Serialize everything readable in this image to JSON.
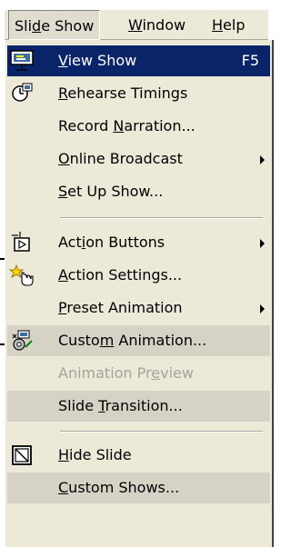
{
  "menubar": {
    "items": [
      {
        "label_pre": "Sli",
        "label_acc": "d",
        "label_post": "e Show"
      },
      {
        "label_pre": "",
        "label_acc": "W",
        "label_post": "indow"
      },
      {
        "label_pre": "",
        "label_acc": "H",
        "label_post": "elp"
      }
    ]
  },
  "menu": {
    "items": [
      {
        "pre": "",
        "acc": "V",
        "post": "iew Show",
        "shortcut": "F5",
        "icon": "view-show-icon",
        "state": "selected"
      },
      {
        "pre": "",
        "acc": "R",
        "post": "ehearse Timings",
        "icon": "rehearse-timings-icon",
        "state": "normal"
      },
      {
        "pre": "Record ",
        "acc": "N",
        "post": "arration...",
        "icon": "",
        "state": "normal"
      },
      {
        "pre": "",
        "acc": "O",
        "post": "nline Broadcast",
        "icon": "",
        "state": "normal",
        "submenu": true
      },
      {
        "pre": "",
        "acc": "S",
        "post": "et Up Show...",
        "icon": "",
        "state": "normal"
      },
      {
        "pre": "Act",
        "acc": "i",
        "post": "on Buttons",
        "icon": "action-buttons-icon",
        "state": "normal",
        "submenu": true
      },
      {
        "pre": "",
        "acc": "A",
        "post": "ction Settings...",
        "icon": "action-settings-icon",
        "state": "normal"
      },
      {
        "pre": "",
        "acc": "P",
        "post": "reset Animation",
        "icon": "",
        "state": "normal",
        "submenu": true
      },
      {
        "pre": "Custo",
        "acc": "m",
        "post": " Animation...",
        "icon": "custom-animation-icon",
        "state": "hover"
      },
      {
        "pre": "Animation Pr",
        "acc": "e",
        "post": "view",
        "icon": "",
        "state": "disabled"
      },
      {
        "pre": "Slide ",
        "acc": "T",
        "post": "ransition...",
        "icon": "",
        "state": "hover"
      },
      {
        "pre": "",
        "acc": "H",
        "post": "ide Slide",
        "icon": "hide-slide-icon",
        "state": "normal"
      },
      {
        "pre": "",
        "acc": "C",
        "post": "ustom Shows...",
        "icon": "",
        "state": "hover"
      }
    ]
  },
  "colors": {
    "menu_bg": "#ece9d8",
    "selected_bg": "#0a246a",
    "disabled_text": "#a6a39a"
  }
}
